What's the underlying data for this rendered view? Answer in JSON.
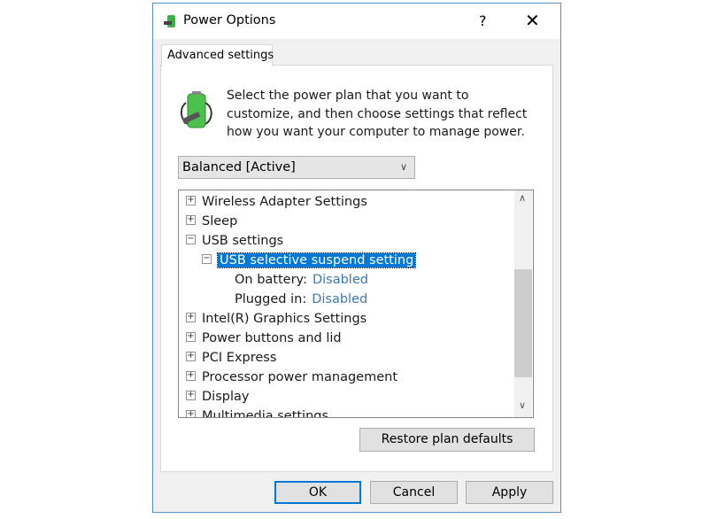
{
  "window": {
    "title": "Power Options",
    "help": "?",
    "close": "✕",
    "icon": "power-options-icon"
  },
  "tab": {
    "label": "Advanced settings"
  },
  "description": "Select the power plan that you want to customize, and then choose settings that reflect how you want your computer to manage power.",
  "plan_select": {
    "value": "Balanced [Active]"
  },
  "tree": [
    {
      "label": "Wireless Adapter Settings",
      "state": "collapsed",
      "level": 0
    },
    {
      "label": "Sleep",
      "state": "collapsed",
      "level": 0
    },
    {
      "label": "USB settings",
      "state": "expanded",
      "level": 0
    },
    {
      "label": "USB selective suspend setting",
      "state": "expanded",
      "level": 1,
      "selected": true
    },
    {
      "label": "On battery:",
      "value": "Disabled",
      "level": 2
    },
    {
      "label": "Plugged in:",
      "value": "Disabled",
      "level": 2
    },
    {
      "label": "Intel(R) Graphics Settings",
      "state": "collapsed",
      "level": 0
    },
    {
      "label": "Power buttons and lid",
      "state": "collapsed",
      "level": 0
    },
    {
      "label": "PCI Express",
      "state": "collapsed",
      "level": 0
    },
    {
      "label": "Processor power management",
      "state": "collapsed",
      "level": 0
    },
    {
      "label": "Display",
      "state": "collapsed",
      "level": 0
    },
    {
      "label": "Multimedia settings",
      "state": "collapsed",
      "level": 0
    }
  ],
  "buttons": {
    "restore": "Restore plan defaults",
    "ok": "OK",
    "cancel": "Cancel",
    "apply": "Apply"
  },
  "colors": {
    "selection": "#0078d7",
    "link": "#3c78b4"
  }
}
